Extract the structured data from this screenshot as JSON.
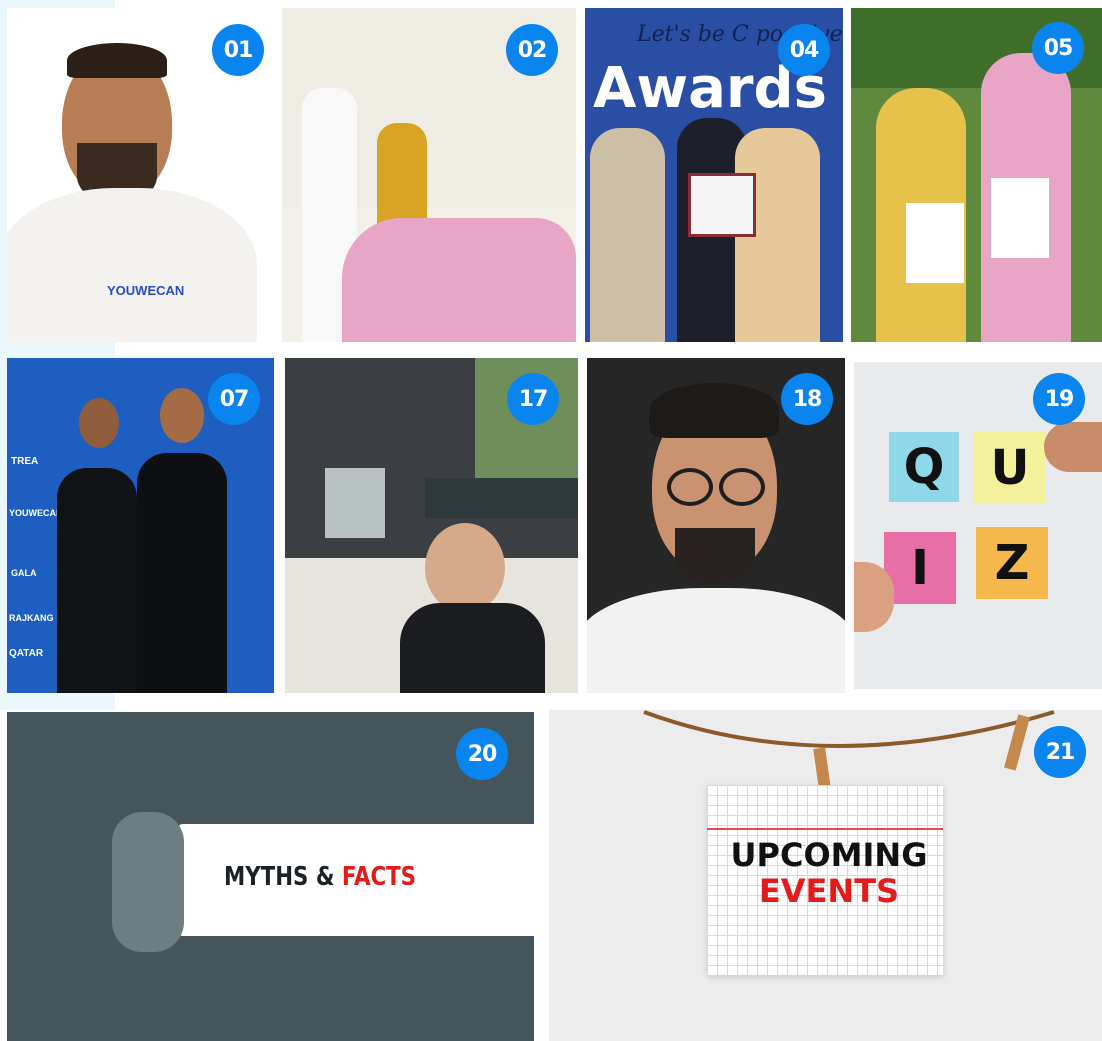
{
  "tiles": [
    {
      "id": "t01",
      "badge": "01",
      "logo": "YOUWECAN"
    },
    {
      "id": "t02",
      "badge": "02"
    },
    {
      "id": "t04",
      "badge": "04",
      "banner": "Let's be C positive",
      "banner_word": "Awards"
    },
    {
      "id": "t05",
      "badge": "05"
    },
    {
      "id": "t07",
      "badge": "07",
      "wall_texts": [
        "TREA",
        "YOUWECAN",
        "RAJKANG",
        "QATAR",
        "GALA"
      ]
    },
    {
      "id": "t17",
      "badge": "17"
    },
    {
      "id": "t18",
      "badge": "18"
    },
    {
      "id": "t19",
      "badge": "19",
      "letters": [
        "Q",
        "U",
        "I",
        "Z"
      ]
    },
    {
      "id": "t20",
      "badge": "20",
      "headline_part1": "MYTHS & ",
      "headline_part2": "FACTS"
    },
    {
      "id": "t21",
      "badge": "21",
      "line1": "UPCOMING",
      "line2": "EVENTS"
    }
  ],
  "colors": {
    "badge": "#0a85f0",
    "accent_red": "#e31b1b",
    "side_strip": "#eaf7fd"
  }
}
